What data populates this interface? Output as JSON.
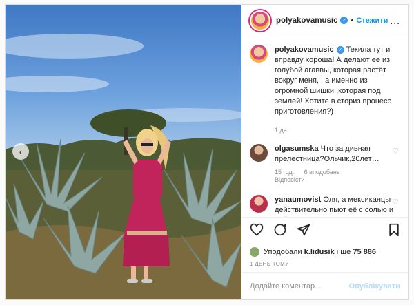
{
  "post": {
    "author": "polyakovamusic",
    "follow_label": "Стежити",
    "separator": "•",
    "more_label": "...",
    "verified_glyph": "✓"
  },
  "caption": {
    "author": "polyakovamusic",
    "text": "Текила тут и вправду хороша! А делают ее из голубой агаввы, которая растёт вокруг меня, , а именно из огромной шишки ,которая под землей! Хотите в сториз процесс приготовления?)",
    "age": "1 дн."
  },
  "comments": [
    {
      "author": "olgasumska",
      "text": "Что за дивная прелестница?Ольчик,20лет…",
      "age": "15 год.",
      "likes": "6 вподобань",
      "reply_label": "Відповісти"
    },
    {
      "author": "yanaumovist",
      "text": "Оля, а мексиканцы действительно пьют её с солью и лаймом?"
    }
  ],
  "likes": {
    "prefix": "Уподобали",
    "user": "k.lidusik",
    "middle": "і ще",
    "count": "75 886"
  },
  "timestamp": "1 ДЕНЬ ТОМУ",
  "comment_box": {
    "placeholder": "Додайте коментар...",
    "publish_label": "Опублікувати"
  },
  "icons": {
    "prev": "chevron-left-icon",
    "like": "heart-icon",
    "comment": "comment-bubble-icon",
    "share": "paper-plane-icon",
    "save": "bookmark-icon"
  },
  "colors": {
    "accent": "#0095f6",
    "verified": "#3897f0",
    "muted": "#8e8e8e",
    "publish_disabled": "#b2dffc",
    "dress": "#c0245a"
  }
}
